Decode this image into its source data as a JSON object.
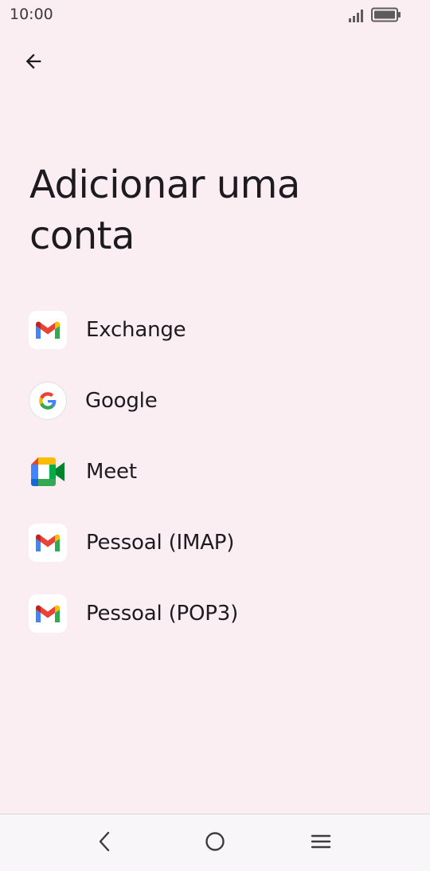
{
  "status_bar": {
    "time": "10:00"
  },
  "header": {
    "back_icon": "arrow-back-icon"
  },
  "title": "Adicionar uma conta",
  "accounts": [
    {
      "label": "Exchange",
      "icon": "gmail-icon"
    },
    {
      "label": "Google",
      "icon": "google-icon"
    },
    {
      "label": "Meet",
      "icon": "meet-icon"
    },
    {
      "label": "Pessoal (IMAP)",
      "icon": "gmail-icon"
    },
    {
      "label": "Pessoal (POP3)",
      "icon": "gmail-icon"
    }
  ],
  "navigation": {
    "back": "nav-back-icon",
    "home": "nav-home-icon",
    "recents": "nav-menu-icon"
  },
  "colors": {
    "background": "#fbeef3",
    "nav_bar": "#f8f6f8",
    "text": "#1d1b20",
    "gmail_red": "#ea4335",
    "gmail_blue": "#4285f4",
    "gmail_green": "#34a853",
    "gmail_yellow": "#fbbc04"
  }
}
